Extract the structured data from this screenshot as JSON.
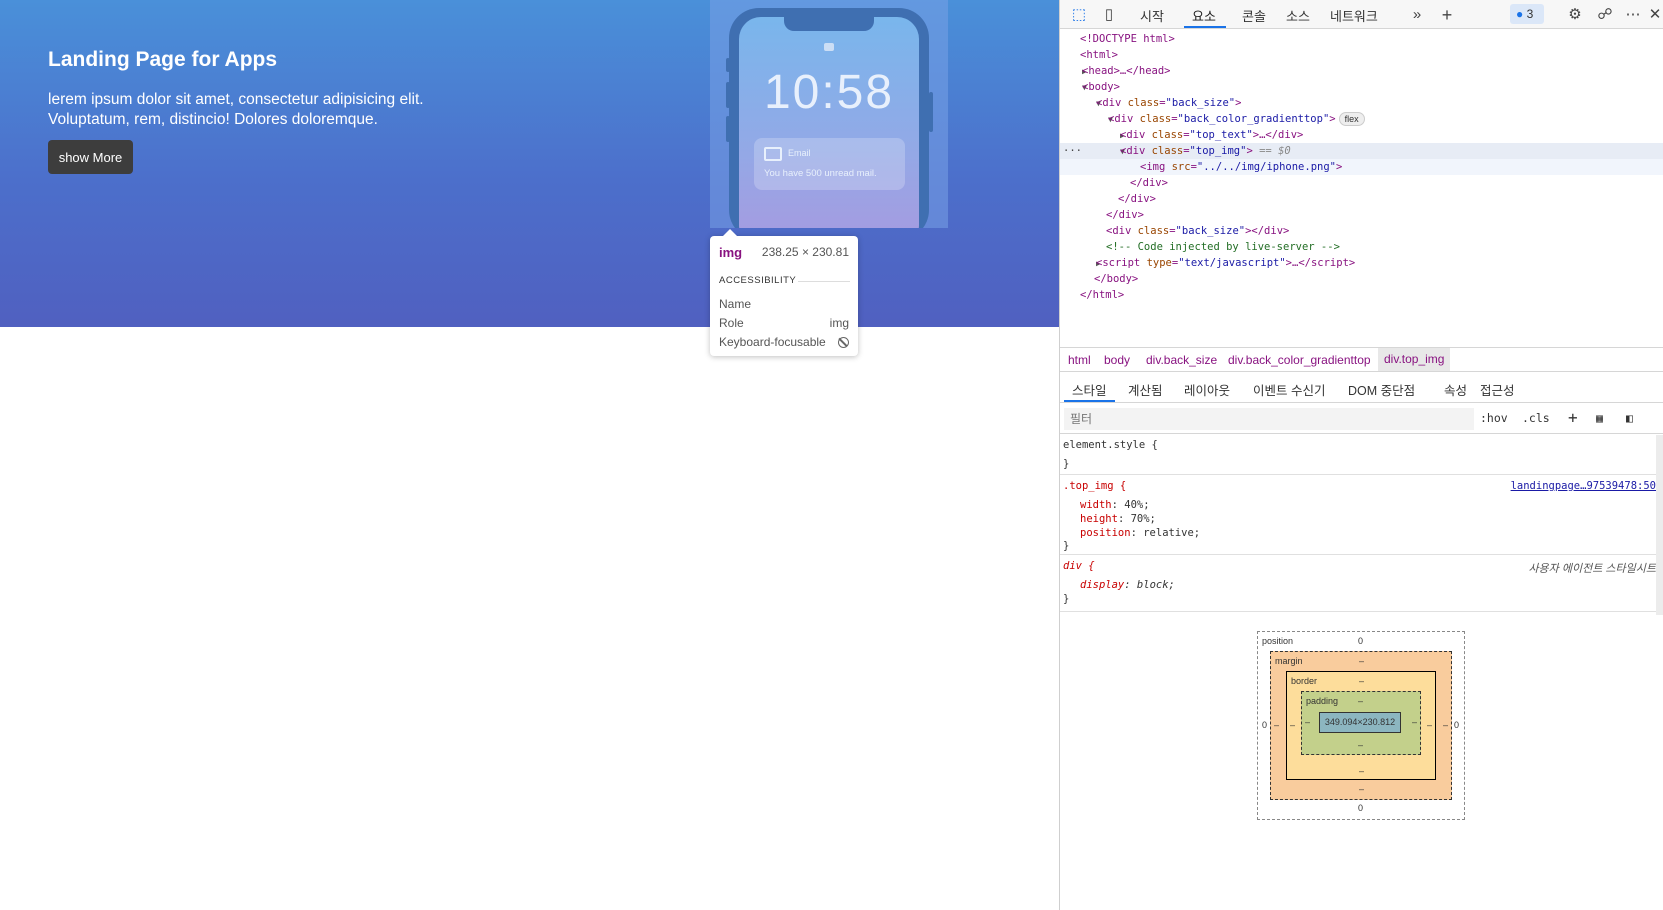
{
  "hero": {
    "title": "Landing Page for Apps",
    "text": "lerem ipsum dolor sit amet, consectetur adipisicing elit. Voluptatum, rem, distincio! Dolores doloremque.",
    "button": "show More",
    "phone": {
      "time": "10:58",
      "notif_title": "Email",
      "notif_msg": "You have 500 unread mail."
    }
  },
  "tooltip": {
    "tag": "img",
    "size": "238.25 × 230.81",
    "section": "ACCESSIBILITY",
    "name_label": "Name",
    "role_label": "Role",
    "role_value": "img",
    "focus_label": "Keyboard-focusable"
  },
  "devtools": {
    "tabs": [
      "시작",
      "요소",
      "콘솔",
      "소스",
      "네트워크"
    ],
    "issues_count": "3",
    "tree": {
      "doctype": "<!DOCTYPE html>",
      "html_open": "<html>",
      "head": "<head>…</head>",
      "body_open": "<body>",
      "div_back_size_open_tag": "div",
      "div_back_size_attr": "class",
      "div_back_size_val": "\"back_size\"",
      "gradient_attr": "class",
      "gradient_val": "\"back_color_gradienttop\"",
      "flex_pill": "flex",
      "top_text_val": "\"top_text\"",
      "top_img_val": "\"top_img\"",
      "eq_hint": "== $0",
      "img_src_attr": "src",
      "img_src_val": "\"../../img/iphone.png\"",
      "close_div": "</div>",
      "back_size_2_val": "\"back_size\"",
      "comment": "<!-- Code injected by live-server -->",
      "script_attr": "type",
      "script_val": "\"text/javascript\"",
      "body_close": "</body>",
      "html_close": "</html>"
    },
    "breadcrumbs": [
      "html",
      "body",
      "div.back_size",
      "div.back_color_gradienttop",
      "div.top_img"
    ],
    "subtabs": [
      "스타일",
      "계산됨",
      "레이아웃",
      "이벤트 수신기",
      "DOM 중단점",
      "속성",
      "접근성"
    ],
    "filter_placeholder": "필터",
    "hov": ":hov",
    "cls": ".cls",
    "rules": {
      "element_style": "element.style {",
      "close": "}",
      "top_img_selector": ".top_img {",
      "top_img_source": "landingpage…97539478:50",
      "width_prop": "width",
      "width_val": "40%;",
      "height_prop": "height",
      "height_val": "70%;",
      "position_prop": "position",
      "position_val": "relative;",
      "div_selector": "div {",
      "ua_label": "사용자 에이전트 스타일시트",
      "display_prop": "display",
      "display_val": "block;"
    },
    "boxmodel": {
      "position_label": "position",
      "position_val": "0",
      "margin_label": "margin",
      "border_label": "border",
      "padding_label": "padding",
      "dash": "–",
      "content": "349.094×230.812",
      "zero": "0"
    }
  }
}
